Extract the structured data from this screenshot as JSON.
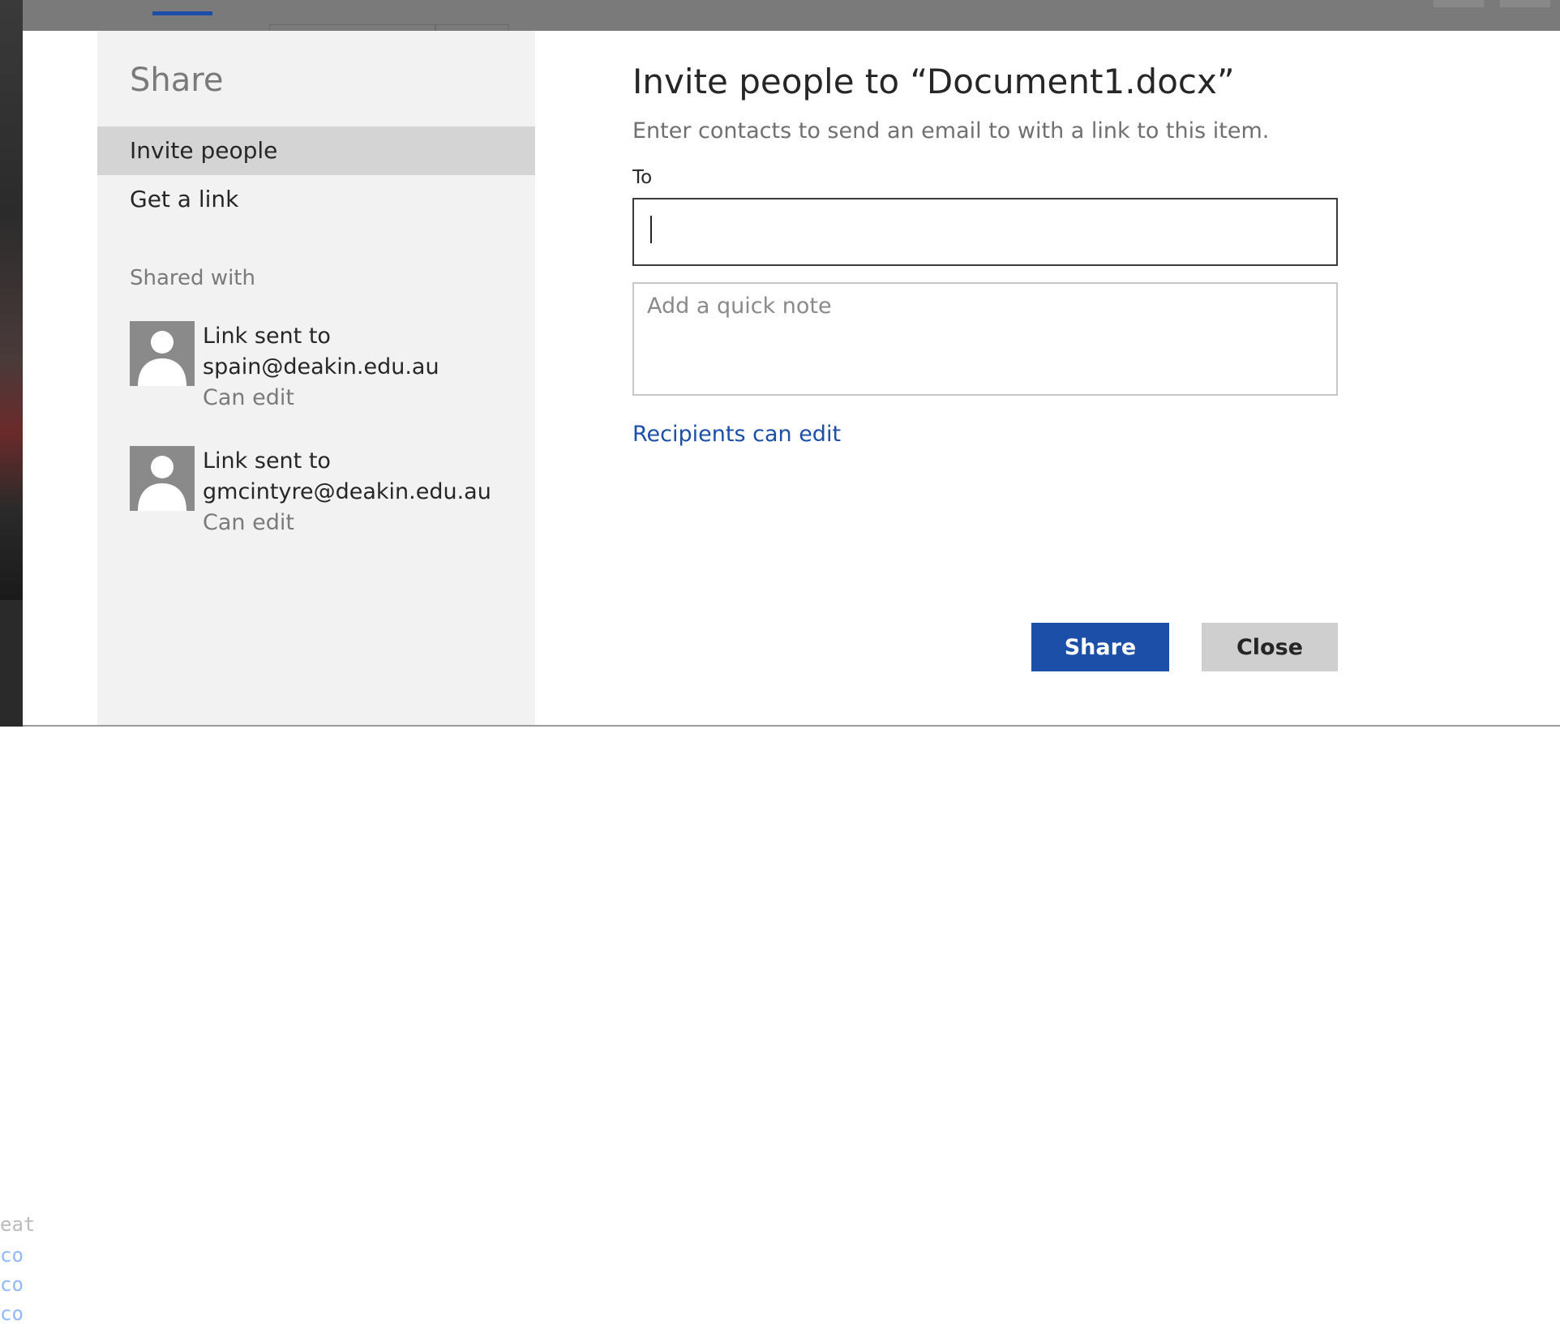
{
  "background": {
    "code_lines": [
      "eat",
      "co",
      "co",
      "co"
    ]
  },
  "nav": {
    "title": "Share",
    "items": [
      {
        "label": "Invite people",
        "active": true
      },
      {
        "label": "Get a link",
        "active": false
      }
    ],
    "shared_with_heading": "Shared with",
    "shared": [
      {
        "line1": "Link sent to",
        "email": "spain@deakin.edu.au",
        "permission": "Can edit"
      },
      {
        "line1": "Link sent to",
        "email": "gmcintyre@deakin.edu.au",
        "permission": "Can edit"
      }
    ]
  },
  "main": {
    "title": "Invite people to “Document1.docx”",
    "description": "Enter contacts to send an email to with a link to this item.",
    "to_label": "To",
    "to_value": "",
    "note_placeholder": "Add a quick note",
    "permission_link": "Recipients can edit"
  },
  "buttons": {
    "share": "Share",
    "close": "Close"
  },
  "colors": {
    "accent": "#1b4fa8",
    "nav_bg": "#f2f2f2",
    "nav_active": "#d4d4d4",
    "avatar_bg": "#8a8a8a"
  }
}
